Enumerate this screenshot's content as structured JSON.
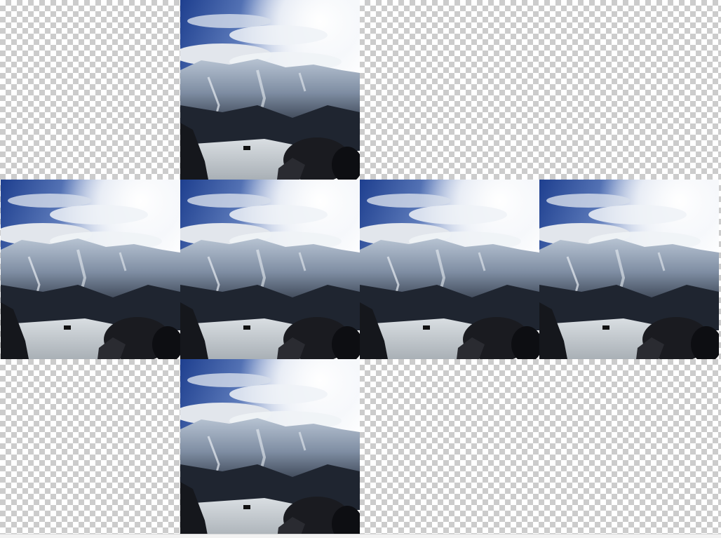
{
  "image": {
    "description_name": "cubemap-cross",
    "face_names": [
      "face-top",
      "face-left",
      "face-front",
      "face-right",
      "face-back",
      "face-bottom"
    ],
    "colors": {
      "checker_light": "#ffffff",
      "checker_dark": "#cccccc",
      "sky_blue": "#3a5aa8",
      "cloud_white": "#f4f6f8",
      "mountain_dark": "#1f2530",
      "snow": "#c9cfd6",
      "rock": "#0d0e12"
    }
  }
}
